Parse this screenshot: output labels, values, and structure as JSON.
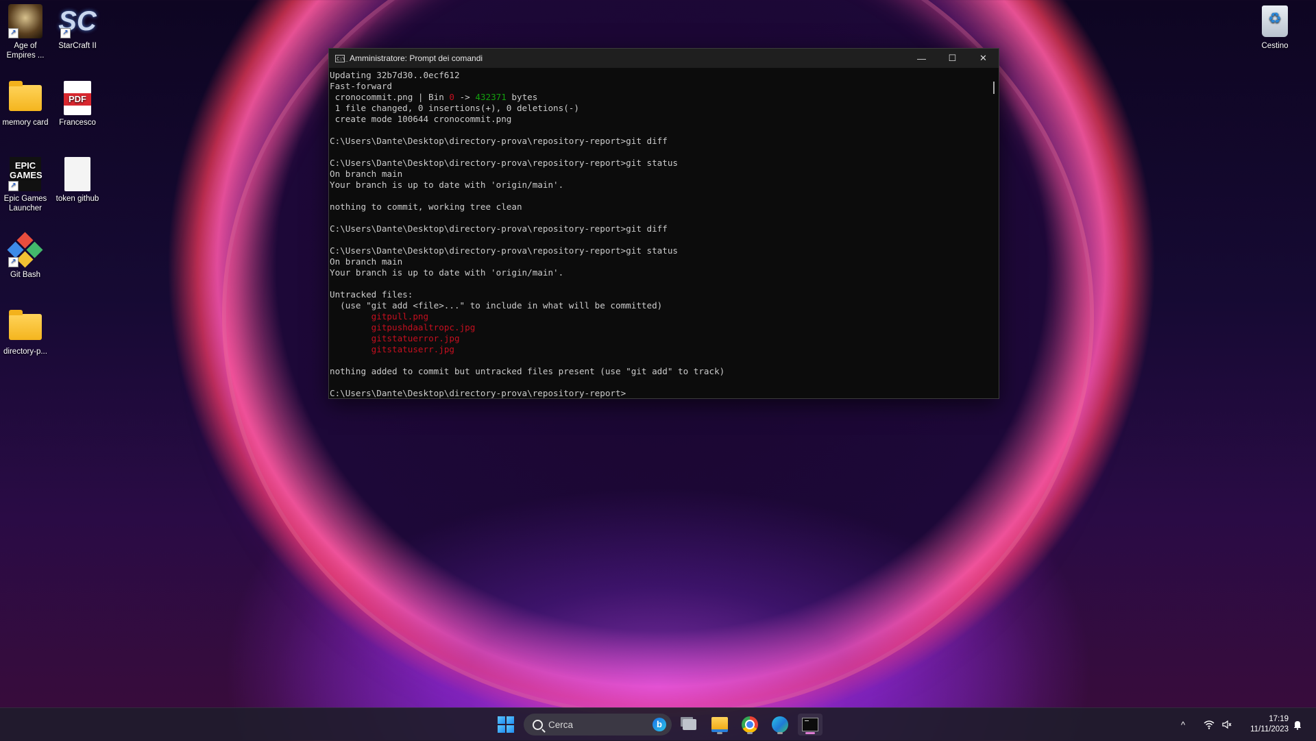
{
  "desktop": {
    "icons": [
      {
        "label": "Age of Empires ...",
        "icon": "age-of-empires-icon"
      },
      {
        "label": "StarCraft II",
        "icon": "starcraft-icon"
      },
      {
        "label": "memory card",
        "icon": "folder-icon"
      },
      {
        "label": "Francesco",
        "icon": "pdf-icon",
        "badge": "PDF"
      },
      {
        "label": "Epic Games Launcher",
        "icon": "epic-games-icon",
        "badge": "EPIC\nGAMES"
      },
      {
        "label": "token github",
        "icon": "text-file-icon"
      },
      {
        "label": "Git Bash",
        "icon": "git-bash-icon"
      },
      {
        "label": "directory-p...",
        "icon": "folder-icon"
      },
      {
        "label": "Cestino",
        "icon": "recycle-bin-icon"
      }
    ]
  },
  "terminal": {
    "title": "Amministratore: Prompt dei comandi",
    "icon_text": "C:\\_",
    "controls": {
      "minimize": "—",
      "maximize": "☐",
      "close": "✕"
    },
    "lines": [
      [
        {
          "t": "Updating 32b7d30..0ecf612"
        }
      ],
      [
        {
          "t": "Fast-forward"
        }
      ],
      [
        {
          "t": " cronocommit.png | Bin "
        },
        {
          "t": "0",
          "c": "red"
        },
        {
          "t": " -> "
        },
        {
          "t": "432371",
          "c": "green"
        },
        {
          "t": " bytes"
        }
      ],
      [
        {
          "t": " 1 file changed, 0 insertions(+), 0 deletions(-)"
        }
      ],
      [
        {
          "t": " create mode 100644 cronocommit.png"
        }
      ],
      [
        {
          "t": ""
        }
      ],
      [
        {
          "t": "C:\\Users\\Dante\\Desktop\\directory-prova\\repository-report>git diff"
        }
      ],
      [
        {
          "t": ""
        }
      ],
      [
        {
          "t": "C:\\Users\\Dante\\Desktop\\directory-prova\\repository-report>git status"
        }
      ],
      [
        {
          "t": "On branch main"
        }
      ],
      [
        {
          "t": "Your branch is up to date with 'origin/main'."
        }
      ],
      [
        {
          "t": ""
        }
      ],
      [
        {
          "t": "nothing to commit, working tree clean"
        }
      ],
      [
        {
          "t": ""
        }
      ],
      [
        {
          "t": "C:\\Users\\Dante\\Desktop\\directory-prova\\repository-report>git diff"
        }
      ],
      [
        {
          "t": ""
        }
      ],
      [
        {
          "t": "C:\\Users\\Dante\\Desktop\\directory-prova\\repository-report>git status"
        }
      ],
      [
        {
          "t": "On branch main"
        }
      ],
      [
        {
          "t": "Your branch is up to date with 'origin/main'."
        }
      ],
      [
        {
          "t": ""
        }
      ],
      [
        {
          "t": "Untracked files:"
        }
      ],
      [
        {
          "t": "  (use \"git add <file>...\" to include in what will be committed)"
        }
      ],
      [
        {
          "t": "        "
        },
        {
          "t": "gitpull.png",
          "c": "red"
        }
      ],
      [
        {
          "t": "        "
        },
        {
          "t": "gitpushdaaltropc.jpg",
          "c": "red"
        }
      ],
      [
        {
          "t": "        "
        },
        {
          "t": "gitstatuerror.jpg",
          "c": "red"
        }
      ],
      [
        {
          "t": "        "
        },
        {
          "t": "gitstatuserr.jpg",
          "c": "red"
        }
      ],
      [
        {
          "t": ""
        }
      ],
      [
        {
          "t": "nothing added to commit but untracked files present (use \"git add\" to track)"
        }
      ],
      [
        {
          "t": ""
        }
      ],
      [
        {
          "t": "C:\\Users\\Dante\\Desktop\\directory-prova\\repository-report>"
        }
      ]
    ]
  },
  "taskbar": {
    "search_placeholder": "Cerca",
    "bing_letter": "b",
    "apps": [
      "start-icon",
      "task-view-icon",
      "file-explorer-icon",
      "chrome-icon",
      "edge-icon",
      "command-prompt-icon"
    ],
    "tray": {
      "chevron": "^",
      "wifi": "wifi-icon",
      "volume": "volume-icon",
      "notifications": "bell-icon"
    },
    "time": "17:19",
    "date": "11/11/2023"
  }
}
